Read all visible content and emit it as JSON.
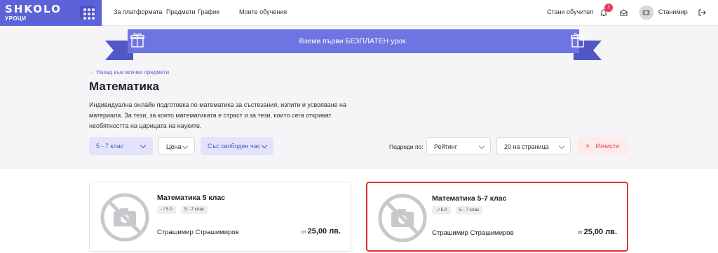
{
  "logo": {
    "brand": "SHKOLO",
    "sub": "УРОЦИ"
  },
  "nav": [
    "За платформата",
    "Предмети",
    "График",
    "Моите обучения"
  ],
  "header_right": {
    "become_teacher": "Стани обучител",
    "notifications": "1",
    "user_name": "Станимир"
  },
  "banner": {
    "text": "Вземи първи БЕЗПЛАТЕН урок."
  },
  "page": {
    "back_link": "← Назад към всички предмети",
    "title": "Математика",
    "description": "Индивидуална онлайн подготовка по математика за състезания, изпити и усвояване на материала. За тези, за които математиката е страст и за тези, които сега откриват необятността на царицата на науките."
  },
  "filters": {
    "grade": "5 - 7 клас",
    "price": "Цена",
    "free_hour": "Със свободен час"
  },
  "sort": {
    "label": "Подреди по:",
    "order": "Рейтинг",
    "per_page": "20 на страница",
    "clear": "Изчисти"
  },
  "courses": [
    {
      "title": "Математика 5 клас",
      "rating": "- / 5.0",
      "grade": "5 - 7 клас",
      "teacher": "Страшимир Страшимиров",
      "price_prefix": "от",
      "price": "25,00 лв."
    },
    {
      "title": "Математика 5-7 клас",
      "rating": "- / 5.0",
      "grade": "5 - 7 клас",
      "teacher": "Страшимир Страшимиров",
      "price_prefix": "от",
      "price": "25,00 лв."
    }
  ],
  "colors": {
    "brand": "#5c63d8",
    "banner": "#6f74e3",
    "highlight": "#d93434"
  }
}
